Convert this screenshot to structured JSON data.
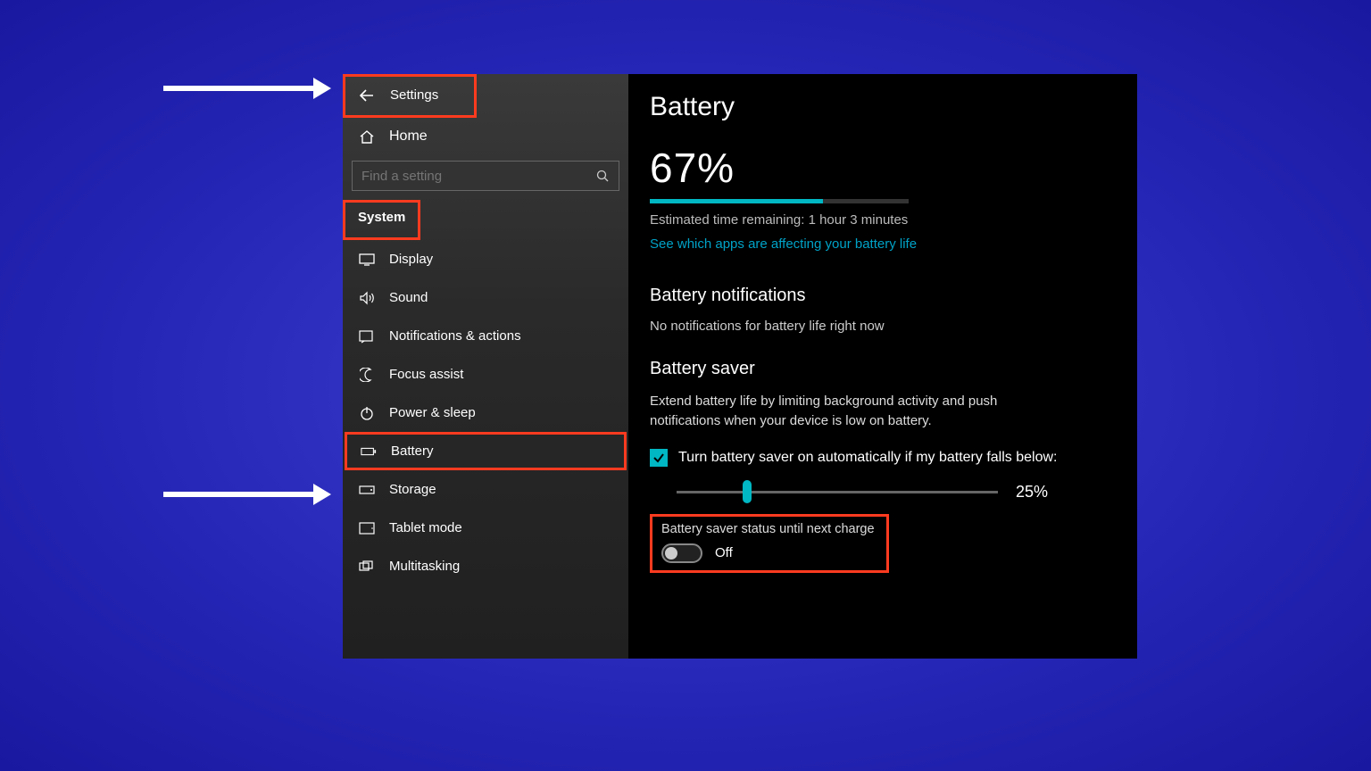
{
  "header": {
    "title": "Settings"
  },
  "sidebar": {
    "home": "Home",
    "search_placeholder": "Find a setting",
    "category": "System",
    "items": [
      {
        "label": "Display"
      },
      {
        "label": "Sound"
      },
      {
        "label": "Notifications & actions"
      },
      {
        "label": "Focus assist"
      },
      {
        "label": "Power & sleep"
      },
      {
        "label": "Battery"
      },
      {
        "label": "Storage"
      },
      {
        "label": "Tablet mode"
      },
      {
        "label": "Multitasking"
      }
    ]
  },
  "main": {
    "title": "Battery",
    "percent": "67%",
    "percent_value": 67,
    "estimated": "Estimated time remaining: 1 hour 3 minutes",
    "apps_link": "See which apps are affecting your battery life",
    "notifications": {
      "title": "Battery notifications",
      "body": "No notifications for battery life right now"
    },
    "saver": {
      "title": "Battery saver",
      "description": "Extend battery life by limiting background activity and push notifications when your device is low on battery.",
      "checkbox_label": "Turn battery saver on automatically if my battery falls below:",
      "checkbox_checked": true,
      "slider_value": "25%",
      "slider_percent": 25,
      "status_label": "Battery saver status until next charge",
      "status_value": "Off"
    }
  },
  "colors": {
    "accent": "#00b7c3",
    "highlight": "#ff3b1f"
  }
}
